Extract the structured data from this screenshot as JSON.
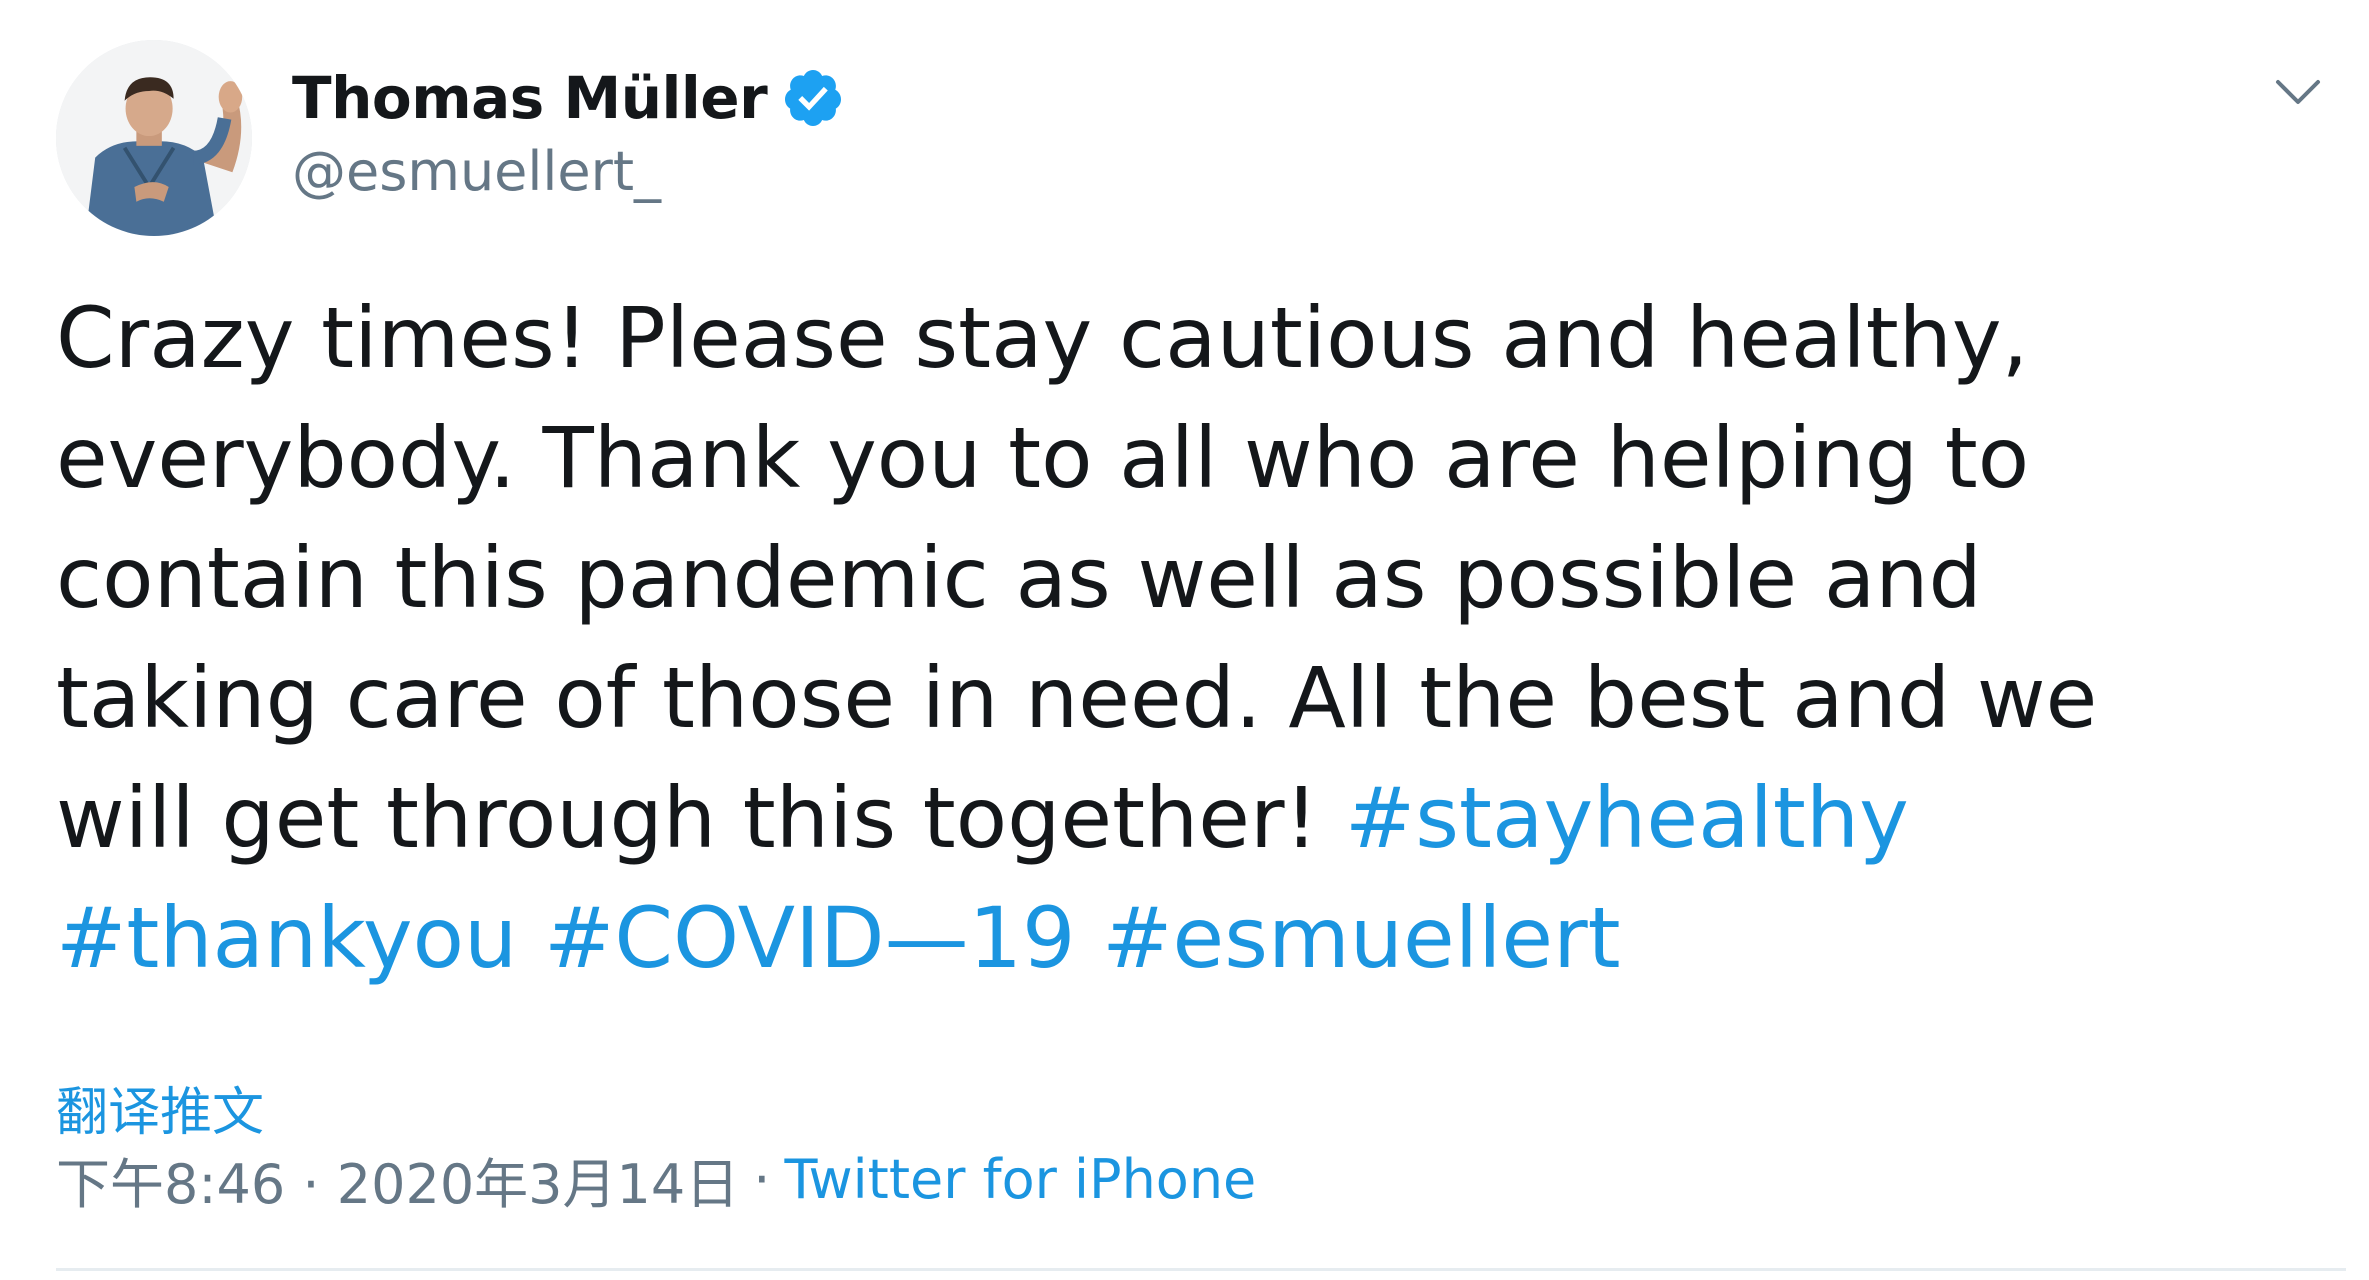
{
  "tweet": {
    "author": {
      "display_name": "Thomas Müller",
      "handle": "@esmuellert_",
      "verified": true,
      "verified_color": "#1da1f2"
    },
    "menu_icon": "chevron-down-icon",
    "body_lines": [
      "Crazy times! Please stay cautious and healthy,",
      "everybody. Thank you to all who are helping to",
      "contain this pandemic as well as possible and",
      "taking care of those in need. All the best and we",
      "will get through this together!"
    ],
    "hashtags": [
      "#stayhealthy",
      "#thankyou",
      "#COVID—19",
      "#esmuellert"
    ],
    "translate_label": "翻译推文",
    "timestamp": "下午8:46 · 2020年3月14日",
    "separator": "·",
    "source": "Twitter for iPhone",
    "link_color": "#1b95e0",
    "text_color": "#14171a",
    "muted_color": "#657786"
  }
}
